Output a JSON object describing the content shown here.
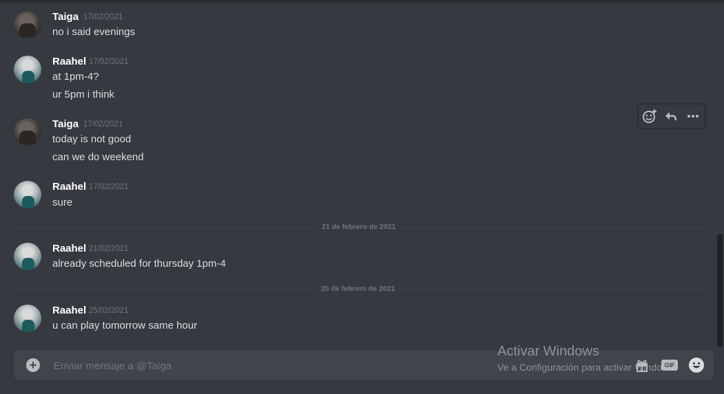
{
  "messages": [
    {
      "author": "Taiga",
      "timestamp": "17/02/2021",
      "avatar": "taiga",
      "lines": [
        "no i said evenings"
      ]
    },
    {
      "author": "Raahel",
      "timestamp": "17/02/2021",
      "avatar": "raahel",
      "lines": [
        "at 1pm-4?",
        "ur 5pm i think"
      ]
    },
    {
      "author": "Taiga",
      "timestamp": "17/02/2021",
      "avatar": "taiga",
      "lines": [
        "today is not good",
        "can we do weekend"
      ]
    },
    {
      "author": "Raahel",
      "timestamp": "17/02/2021",
      "avatar": "raahel",
      "lines": [
        "sure"
      ]
    },
    {
      "author": "Raahel",
      "timestamp": "21/02/2021",
      "avatar": "raahel",
      "lines": [
        "already scheduled for thursday 1pm-4"
      ]
    },
    {
      "author": "Raahel",
      "timestamp": "25/02/2021",
      "avatar": "raahel",
      "lines": [
        "u can play tomorrow same hour"
      ]
    }
  ],
  "dividers": [
    "21 de febrero de 2021",
    "25 de febrero de 2021"
  ],
  "hover_toolbar": {
    "icons": [
      "add-reaction-icon",
      "reply-icon",
      "more-options-icon"
    ]
  },
  "composer": {
    "placeholder": "Enviar mensaje a @Taiga",
    "value": "",
    "icons": [
      "gift-icon",
      "gif-icon",
      "emoji-icon"
    ],
    "gif_label": "GIF",
    "plus_label": "+"
  },
  "watermark": {
    "title": "Activar Windows",
    "subtitle": "Ve a Configuración para activar Windows."
  },
  "colors": {
    "background": "#36393f",
    "text": "#dcddde",
    "muted": "#72767d",
    "composer": "#40444b"
  }
}
